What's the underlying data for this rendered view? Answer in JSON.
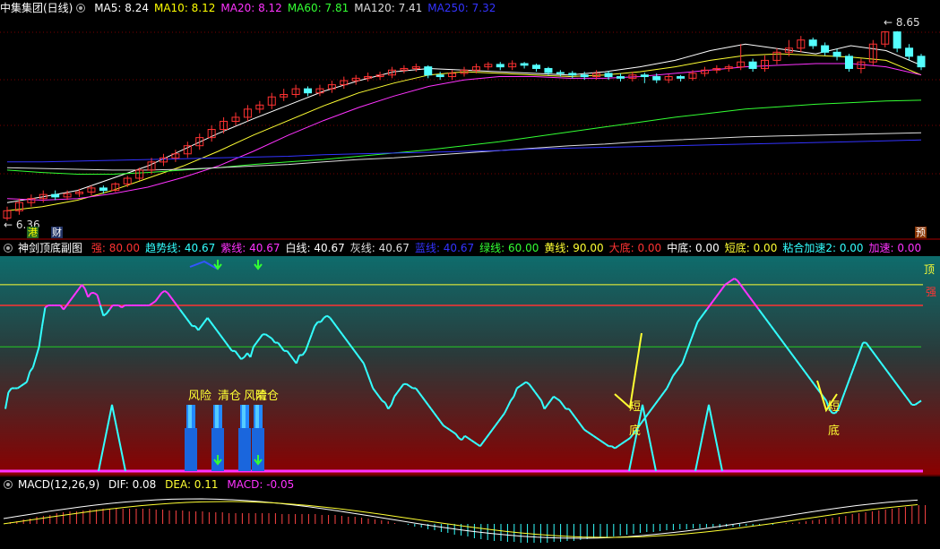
{
  "main": {
    "title": "中集集团(日线)",
    "ma": [
      {
        "label": "MA5: 8.24",
        "color": "#ffffff"
      },
      {
        "label": "MA10: 8.12",
        "color": "#ffff00"
      },
      {
        "label": "MA20: 8.12",
        "color": "#ff33ff"
      },
      {
        "label": "MA60: 7.81",
        "color": "#33ff33"
      },
      {
        "label": "MA120: 7.41",
        "color": "#dddddd"
      },
      {
        "label": "MA250: 7.32",
        "color": "#3333ff"
      }
    ],
    "high_label": "8.65",
    "low_label": "6.36",
    "tag_gang": "港",
    "tag_cai": "财",
    "tag_yu": "预"
  },
  "indicator": {
    "title": "神剑顶底副图",
    "values": [
      {
        "label": "强: 80.00",
        "color": "#ff3333"
      },
      {
        "label": "趋势线: 40.67",
        "color": "#33ffff"
      },
      {
        "label": "紫线: 40.67",
        "color": "#ff33ff"
      },
      {
        "label": "白线: 40.67",
        "color": "#ffffff"
      },
      {
        "label": "灰线: 40.67",
        "color": "#dddddd"
      },
      {
        "label": "蓝线: 40.67",
        "color": "#3333ff"
      },
      {
        "label": "绿线: 60.00",
        "color": "#33ff33"
      },
      {
        "label": "黄线: 90.00",
        "color": "#ffff33"
      },
      {
        "label": "大底: 0.00",
        "color": "#ff3333"
      },
      {
        "label": "中底: 0.00",
        "color": "#ffffff"
      },
      {
        "label": "短底: 0.00",
        "color": "#ffff33"
      },
      {
        "label": "粘合加速2: 0.00",
        "color": "#33ffff"
      },
      {
        "label": "加速: 0.00",
        "color": "#ff33ff"
      }
    ],
    "label_ding": "顶",
    "label_qiang": "强",
    "label_fengxian": "风险",
    "label_qingcang": "清仓",
    "label_fengxian2": "风险",
    "label_qingcang2": "清仓",
    "label_duan_a": "短",
    "label_di_a": "底",
    "label_duan_b": "短",
    "label_di_b": "底"
  },
  "macd": {
    "title": "MACD(12,26,9)",
    "dif": "DIF: 0.08",
    "dea": "DEA: 0.11",
    "macd": "MACD: -0.05"
  },
  "chart_data": [
    {
      "type": "candlestick",
      "title": "中集集团(日线)",
      "ylim": [
        6.2,
        8.8
      ],
      "high": 8.65,
      "low": 6.36,
      "colors": {
        "up": "#ff3232",
        "down": "#54ffff"
      },
      "candles": [
        [
          6.36,
          6.45,
          6.33,
          6.5
        ],
        [
          6.45,
          6.55,
          6.4,
          6.6
        ],
        [
          6.55,
          6.6,
          6.5,
          6.65
        ],
        [
          6.6,
          6.65,
          6.55,
          6.7
        ],
        [
          6.65,
          6.62,
          6.58,
          6.7
        ],
        [
          6.62,
          6.66,
          6.58,
          6.7
        ],
        [
          6.66,
          6.68,
          6.62,
          6.72
        ],
        [
          6.68,
          6.73,
          6.64,
          6.76
        ],
        [
          6.73,
          6.7,
          6.66,
          6.76
        ],
        [
          6.7,
          6.78,
          6.68,
          6.8
        ],
        [
          6.78,
          6.85,
          6.74,
          6.88
        ],
        [
          6.85,
          6.95,
          6.82,
          6.98
        ],
        [
          6.95,
          7.05,
          6.9,
          7.1
        ],
        [
          7.05,
          7.1,
          7.0,
          7.15
        ],
        [
          7.1,
          7.15,
          7.05,
          7.2
        ],
        [
          7.15,
          7.25,
          7.1,
          7.3
        ],
        [
          7.25,
          7.35,
          7.2,
          7.4
        ],
        [
          7.35,
          7.45,
          7.3,
          7.5
        ],
        [
          7.45,
          7.55,
          7.4,
          7.6
        ],
        [
          7.55,
          7.6,
          7.5,
          7.66
        ],
        [
          7.6,
          7.7,
          7.55,
          7.75
        ],
        [
          7.7,
          7.75,
          7.65,
          7.8
        ],
        [
          7.75,
          7.85,
          7.7,
          7.9
        ],
        [
          7.85,
          7.88,
          7.8,
          7.95
        ],
        [
          7.88,
          7.95,
          7.84,
          8.0
        ],
        [
          7.95,
          7.9,
          7.86,
          7.98
        ],
        [
          7.9,
          7.95,
          7.86,
          8.0
        ],
        [
          7.95,
          8.0,
          7.9,
          8.05
        ],
        [
          8.0,
          8.05,
          7.95,
          8.1
        ],
        [
          8.05,
          8.08,
          8.0,
          8.12
        ],
        [
          8.08,
          8.1,
          8.04,
          8.15
        ],
        [
          8.1,
          8.12,
          8.06,
          8.16
        ],
        [
          8.12,
          8.18,
          8.08,
          8.22
        ],
        [
          8.18,
          8.2,
          8.14,
          8.24
        ],
        [
          8.2,
          8.22,
          8.16,
          8.26
        ],
        [
          8.22,
          8.12,
          8.08,
          8.24
        ],
        [
          8.12,
          8.1,
          8.06,
          8.16
        ],
        [
          8.1,
          8.14,
          8.06,
          8.18
        ],
        [
          8.14,
          8.18,
          8.1,
          8.22
        ],
        [
          8.18,
          8.22,
          8.14,
          8.26
        ],
        [
          8.22,
          8.25,
          8.18,
          8.28
        ],
        [
          8.25,
          8.22,
          8.18,
          8.28
        ],
        [
          8.22,
          8.26,
          8.18,
          8.3
        ],
        [
          8.26,
          8.24,
          8.2,
          8.28
        ],
        [
          8.24,
          8.2,
          8.16,
          8.26
        ],
        [
          8.2,
          8.15,
          8.12,
          8.22
        ],
        [
          8.15,
          8.14,
          8.1,
          8.18
        ],
        [
          8.14,
          8.12,
          8.08,
          8.17
        ],
        [
          8.12,
          8.1,
          8.06,
          8.16
        ],
        [
          8.1,
          8.14,
          8.06,
          8.18
        ],
        [
          8.14,
          8.1,
          8.06,
          8.17
        ],
        [
          8.1,
          8.08,
          8.04,
          8.14
        ],
        [
          8.08,
          8.12,
          8.04,
          8.16
        ],
        [
          8.12,
          8.1,
          8.02,
          8.15
        ],
        [
          8.1,
          8.06,
          8.02,
          8.14
        ],
        [
          8.06,
          8.1,
          8.02,
          8.13
        ],
        [
          8.1,
          8.08,
          8.04,
          8.12
        ],
        [
          8.08,
          8.14,
          8.05,
          8.18
        ],
        [
          8.14,
          8.18,
          8.1,
          8.22
        ],
        [
          8.18,
          8.2,
          8.14,
          8.24
        ],
        [
          8.2,
          8.22,
          8.16,
          8.25
        ],
        [
          8.22,
          8.28,
          8.18,
          8.5
        ],
        [
          8.28,
          8.2,
          8.16,
          8.32
        ],
        [
          8.2,
          8.3,
          8.16,
          8.36
        ],
        [
          8.3,
          8.4,
          8.25,
          8.45
        ],
        [
          8.4,
          8.45,
          8.35,
          8.55
        ],
        [
          8.45,
          8.55,
          8.4,
          8.6
        ],
        [
          8.55,
          8.48,
          8.44,
          8.58
        ],
        [
          8.48,
          8.4,
          8.36,
          8.52
        ],
        [
          8.4,
          8.35,
          8.3,
          8.44
        ],
        [
          8.35,
          8.2,
          8.16,
          8.38
        ],
        [
          8.2,
          8.28,
          8.14,
          8.32
        ],
        [
          8.28,
          8.5,
          8.24,
          8.55
        ],
        [
          8.5,
          8.65,
          8.46,
          8.66
        ],
        [
          8.65,
          8.45,
          8.4,
          8.66
        ],
        [
          8.45,
          8.35,
          8.3,
          8.5
        ],
        [
          8.35,
          8.22,
          8.18,
          8.38
        ]
      ],
      "ma": {
        "MA5": [
          6.55,
          6.62,
          6.7,
          6.85,
          7.0,
          7.2,
          7.4,
          7.58,
          7.75,
          7.92,
          8.05,
          8.16,
          8.2,
          8.18,
          8.16,
          8.14,
          8.12,
          8.16,
          8.22,
          8.3,
          8.42,
          8.5,
          8.44,
          8.38,
          8.48,
          8.42,
          8.24
        ],
        "MA10": [
          6.45,
          6.5,
          6.58,
          6.7,
          6.85,
          7.0,
          7.18,
          7.38,
          7.56,
          7.74,
          7.9,
          8.02,
          8.12,
          8.16,
          8.14,
          8.12,
          8.1,
          8.12,
          8.16,
          8.22,
          8.3,
          8.36,
          8.38,
          8.36,
          8.34,
          8.3,
          8.12
        ],
        "MA20": [
          6.6,
          6.58,
          6.6,
          6.66,
          6.74,
          6.86,
          7.0,
          7.18,
          7.38,
          7.56,
          7.72,
          7.86,
          7.98,
          8.06,
          8.1,
          8.1,
          8.08,
          8.08,
          8.1,
          8.14,
          8.18,
          8.22,
          8.24,
          8.26,
          8.26,
          8.22,
          8.12
        ],
        "MA60": [
          6.95,
          6.92,
          6.9,
          6.9,
          6.92,
          6.95,
          6.98,
          7.02,
          7.05,
          7.08,
          7.12,
          7.16,
          7.2,
          7.25,
          7.3,
          7.36,
          7.42,
          7.48,
          7.54,
          7.6,
          7.65,
          7.7,
          7.73,
          7.76,
          7.78,
          7.8,
          7.81
        ],
        "MA120": [
          6.98,
          6.97,
          6.96,
          6.95,
          6.95,
          6.96,
          6.98,
          7.0,
          7.02,
          7.05,
          7.08,
          7.1,
          7.13,
          7.16,
          7.19,
          7.22,
          7.25,
          7.27,
          7.3,
          7.32,
          7.34,
          7.36,
          7.37,
          7.38,
          7.39,
          7.4,
          7.41
        ],
        "MA250": [
          7.05,
          7.05,
          7.06,
          7.07,
          7.08,
          7.09,
          7.1,
          7.11,
          7.12,
          7.14,
          7.15,
          7.16,
          7.17,
          7.18,
          7.19,
          7.21,
          7.22,
          7.23,
          7.24,
          7.25,
          7.26,
          7.27,
          7.28,
          7.29,
          7.3,
          7.31,
          7.32
        ]
      }
    },
    {
      "type": "line",
      "title": "神剑顶底副图",
      "ylim": [
        0,
        100
      ],
      "levels": {
        "顶": 90,
        "强": 80,
        "绿线": 60
      },
      "trend": [
        30,
        38,
        40,
        40,
        40,
        41,
        42,
        43,
        48,
        50,
        55,
        60,
        70,
        79,
        80,
        80,
        80,
        80,
        80,
        78,
        80,
        82,
        84,
        86,
        88,
        90,
        88,
        84,
        86,
        86,
        85,
        80,
        75,
        76,
        78,
        80,
        80,
        80,
        79,
        80,
        80,
        80,
        80,
        80,
        80,
        80,
        80,
        80,
        81,
        82,
        84,
        86,
        87,
        86,
        84,
        82,
        80,
        78,
        76,
        74,
        72,
        70,
        70,
        68,
        70,
        72,
        74,
        72,
        70,
        68,
        66,
        64,
        62,
        60,
        58,
        58,
        56,
        54,
        55,
        57,
        55,
        60,
        62,
        64,
        66,
        66,
        65,
        64,
        62,
        62,
        60,
        58,
        58,
        56,
        54,
        52,
        56,
        56,
        58,
        62,
        66,
        70,
        72,
        72,
        74,
        75,
        74,
        72,
        70,
        68,
        66,
        64,
        62,
        60,
        58,
        56,
        54,
        52,
        48,
        44,
        40,
        38,
        36,
        34,
        33,
        30,
        32,
        36,
        38,
        40,
        42,
        42,
        41,
        40,
        40,
        38,
        36,
        34,
        32,
        30,
        28,
        26,
        24,
        22,
        21,
        20,
        19,
        18,
        16,
        15,
        17,
        16,
        15,
        14,
        13,
        12,
        14,
        16,
        18,
        20,
        22,
        24,
        26,
        28,
        31,
        34,
        36,
        40,
        41,
        42,
        43,
        42,
        40,
        38,
        36,
        34,
        30,
        32,
        34,
        36,
        35,
        34,
        32,
        30,
        30,
        28,
        26,
        24,
        22,
        20,
        19,
        18,
        17,
        16,
        15,
        14,
        13,
        12,
        12,
        11,
        12,
        13,
        14,
        15,
        16,
        18,
        20,
        22,
        24,
        26,
        28,
        30,
        32,
        34,
        36,
        38,
        40,
        43,
        46,
        48,
        50,
        52,
        56,
        60,
        64,
        68,
        72,
        74,
        76,
        78,
        80,
        82,
        84,
        86,
        88,
        90,
        91,
        92,
        93,
        92,
        90,
        88,
        86,
        84,
        82,
        80,
        78,
        76,
        74,
        72,
        70,
        68,
        66,
        64,
        62,
        60,
        58,
        56,
        54,
        52,
        50,
        48,
        46,
        44,
        42,
        40,
        38,
        36,
        34,
        30,
        28,
        28,
        30,
        34,
        38,
        42,
        46,
        50,
        54,
        58,
        62,
        62,
        60,
        58,
        56,
        54,
        52,
        50,
        48,
        46,
        44,
        42,
        40,
        38,
        36,
        34,
        32,
        32,
        33,
        34
      ],
      "signals": {
        "风险": 2,
        "清仓": 2,
        "短底": 2
      }
    },
    {
      "type": "bar",
      "title": "MACD(12,26,9)",
      "DIF": 0.08,
      "DEA": 0.11,
      "MACD": -0.05
    }
  ]
}
